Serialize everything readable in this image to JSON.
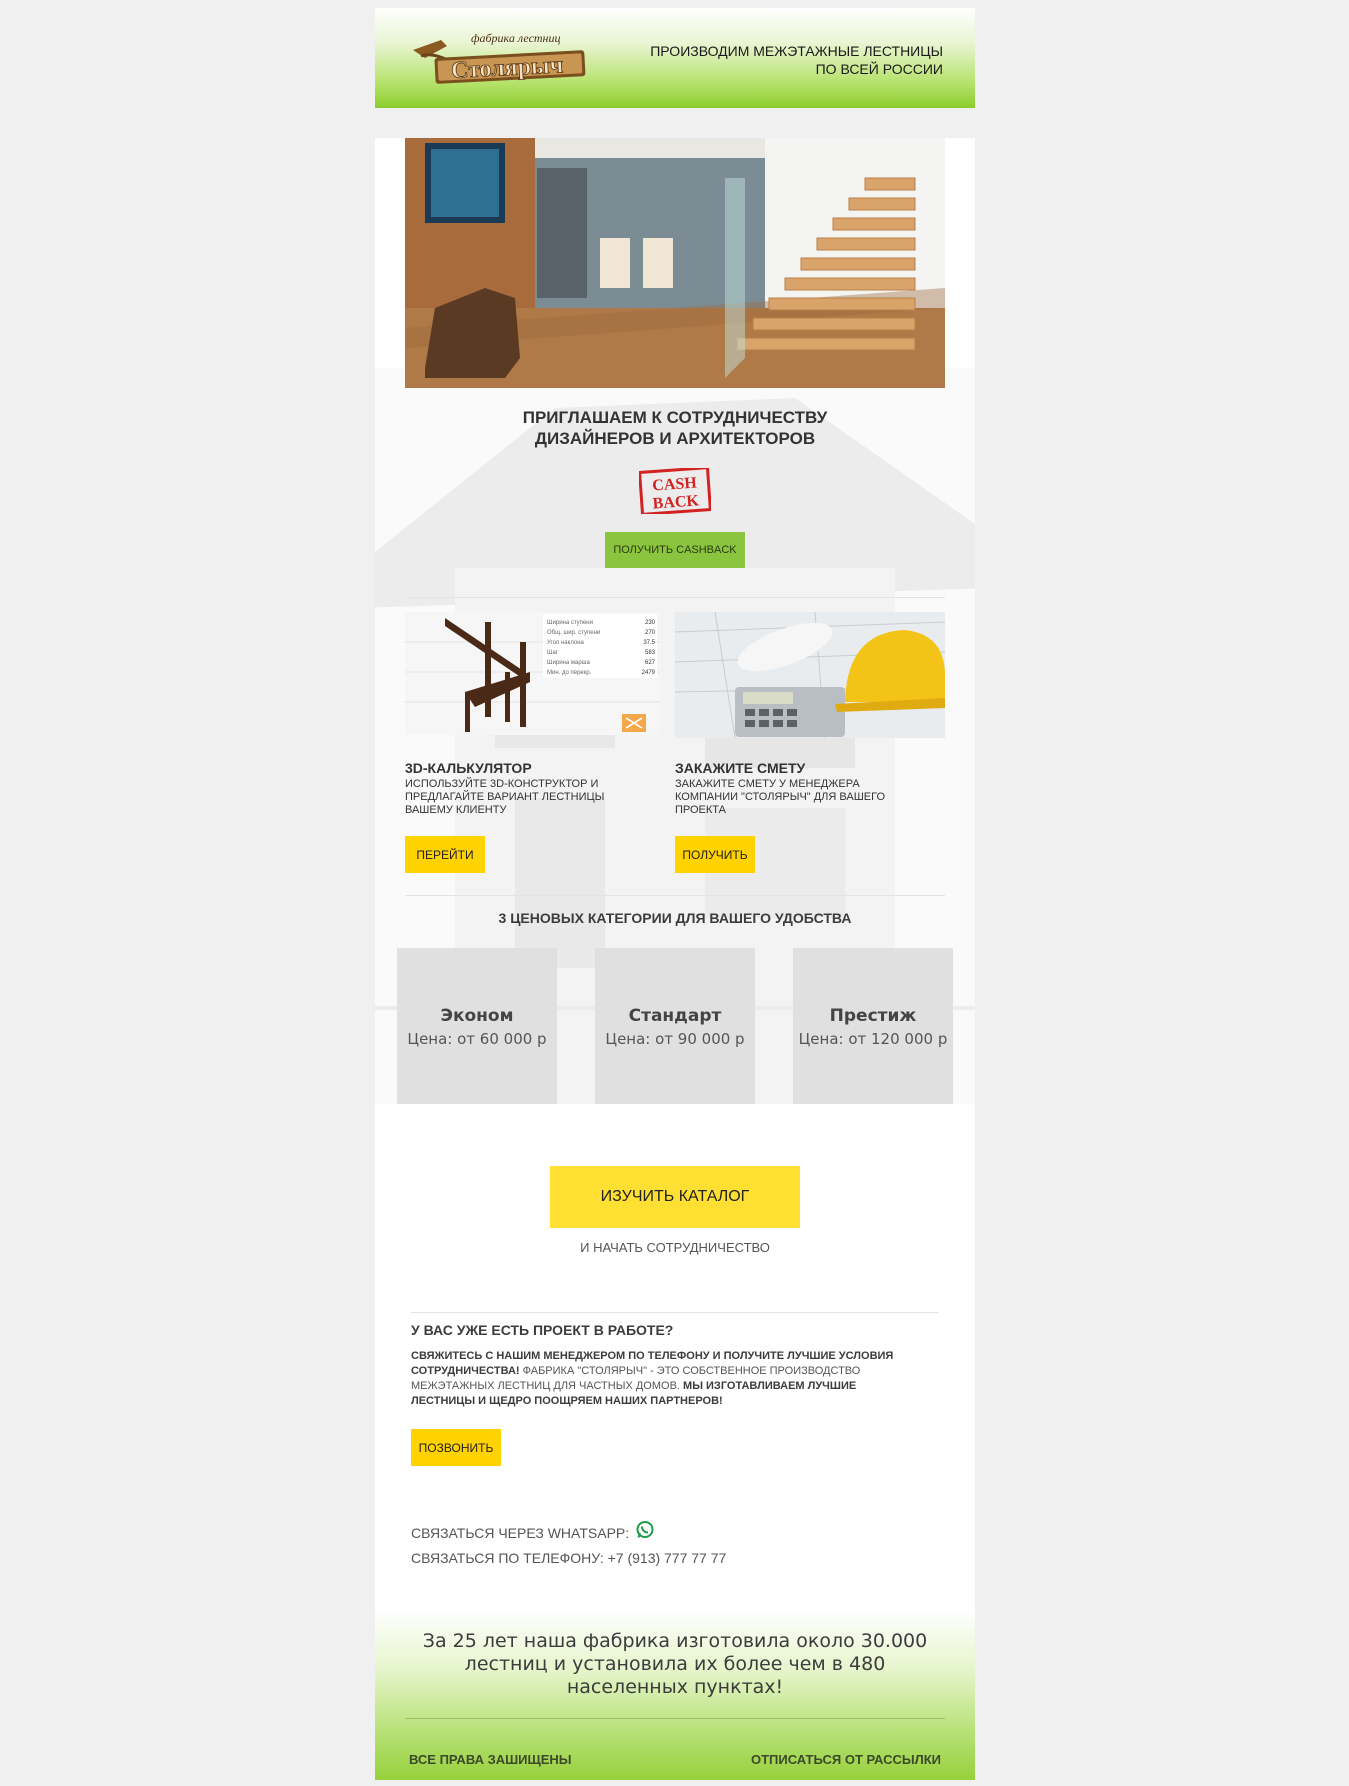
{
  "header": {
    "logo_small": "фабрика лестниц",
    "logo_big": "Столярыч",
    "tagline_line1": "ПРОИЗВОДИМ МЕЖЭТАЖНЫЕ ЛЕСТНИЦЫ",
    "tagline_line2": "ПО ВСЕЙ РОССИИ"
  },
  "invite": {
    "line1": "ПРИГЛАШАЕМ К СОТРУДНИЧЕСТВУ",
    "line2": "ДИЗАЙНЕРОВ И АРХИТЕКТОРОВ",
    "stamp_line1": "CASH",
    "stamp_line2": "BACK",
    "button": "ПОЛУЧИТЬ CASHBACK"
  },
  "cards": [
    {
      "title": "3D-КАЛЬКУЛЯТОР",
      "text": "ИСПОЛЬЗУЙТЕ 3D-КОНСТРУКТОР И ПРЕДЛАГАЙТЕ ВАРИАНТ ЛЕСТНИЦЫ ВАШЕМУ КЛИЕНТУ",
      "button": "ПЕРЕЙТИ",
      "calc_rows": [
        {
          "label": "Ширина ступени",
          "value": "230"
        },
        {
          "label": "Общ. шир. ступени",
          "value": "270"
        },
        {
          "label": "Угол наклона",
          "value": "37.5"
        },
        {
          "label": "Шаг",
          "value": "583"
        },
        {
          "label": "Ширина марша",
          "value": "627"
        },
        {
          "label": "Мин. до перекр.",
          "value": "2479"
        }
      ]
    },
    {
      "title": "ЗАКАЖИТЕ СМЕТУ",
      "text": "ЗАКАЖИТЕ СМЕТУ У МЕНЕДЖЕРА КОМПАНИИ \"СТОЛЯРЫЧ\" ДЛЯ ВАШЕГО ПРОЕКТА",
      "button": "ПОЛУЧИТЬ"
    }
  ],
  "categories": {
    "heading": "3 ЦЕНОВЫХ КАТЕГОРИИ ДЛЯ ВАШЕГО УДОБСТВА",
    "tiers": [
      {
        "name": "Эконом",
        "price": "Цена: от 60 000 р"
      },
      {
        "name": "Стандарт",
        "price": "Цена: от 90 000 р"
      },
      {
        "name": "Престиж",
        "price": "Цена: от 120 000 р"
      }
    ]
  },
  "catalog": {
    "button": "ИЗУЧИТЬ КАТАЛОГ",
    "subtitle": "И НАЧАТЬ СОТРУДНИЧЕСТВО"
  },
  "project": {
    "title": "У ВАС УЖЕ ЕСТЬ ПРОЕКТ В РАБОТЕ?",
    "bold1": "СВЯЖИТЕСЬ С НАШИМ МЕНЕДЖЕРОМ ПО ТЕЛЕФОНУ И ПОЛУЧИТЕ ЛУЧШИЕ УСЛОВИЯ СОТРУДНИЧЕСТВА!",
    "normal": " ФАБРИКА \"СТОЛЯРЫЧ\" - ЭТО СОБСТВЕННОЕ ПРОИЗВОДСТВО МЕЖЭТАЖНЫХ ЛЕСТНИЦ ДЛЯ ЧАСТНЫХ ДОМОВ. ",
    "bold2": "МЫ ИЗГОТАВЛИВАЕМ ЛУЧШИЕ ЛЕСТНИЦЫ И ЩЕДРО ПООЩРЯЕМ НАШИХ ПАРТНЕРОВ!",
    "button": "ПОЗВОНИТЬ"
  },
  "contacts": {
    "whatsapp": "СВЯЗАТЬСЯ ЧЕРЕЗ WHATSAPP:",
    "phone": "СВЯЗАТЬСЯ ПО ТЕЛЕФОНУ: +7 (913) 777 77 77"
  },
  "footer": {
    "text": "За 25 лет наша фабрика изготовила около 30.000 лестниц и установила их более чем в 480 населенных пунктах!",
    "rights": "ВСЕ ПРАВА ЗАШИЩЕНЫ",
    "unsubscribe": "ОТПИСАТЬСЯ ОТ РАССЫЛКИ"
  },
  "colors": {
    "brand_green": "#8bc540",
    "accent_yellow": "#ffd200",
    "catalog_yellow": "#ffe032",
    "tier_gray": "#e0e0e0"
  }
}
